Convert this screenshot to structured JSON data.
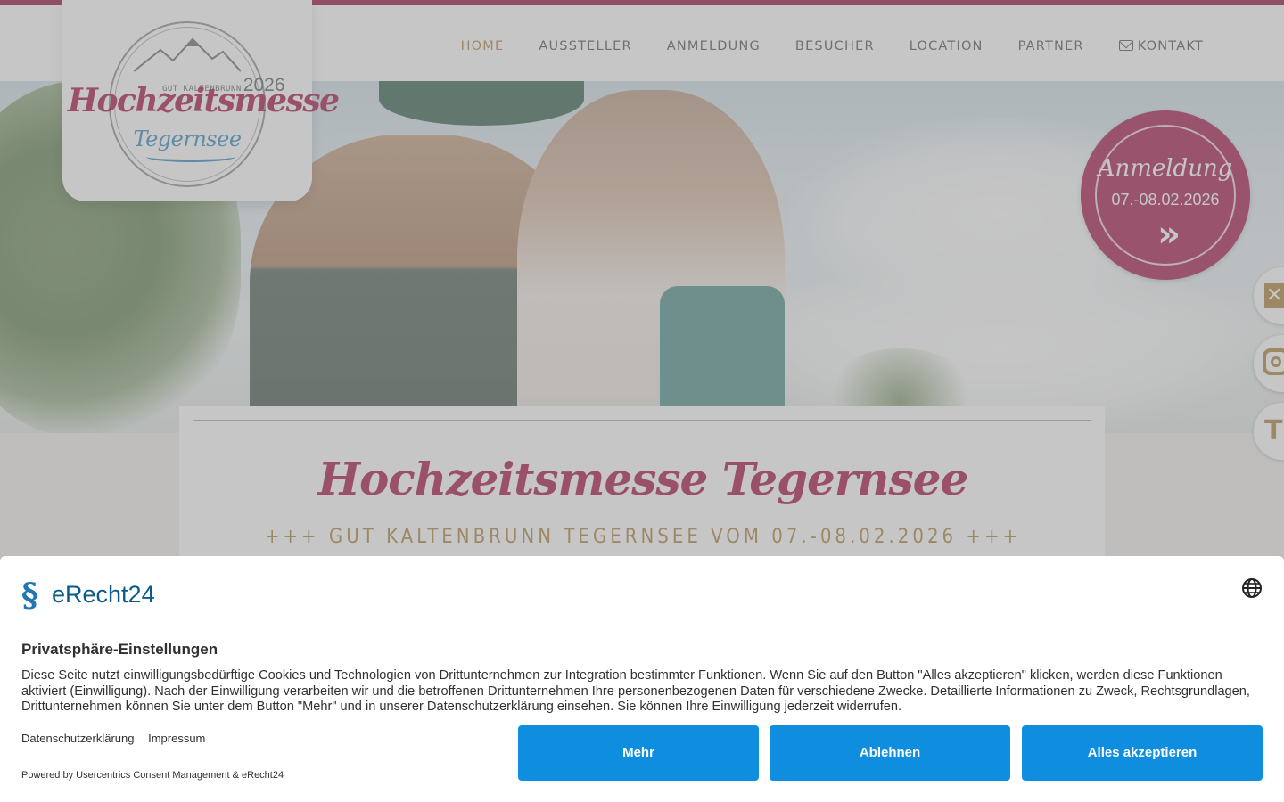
{
  "nav": {
    "items": [
      {
        "label": "HOME",
        "active": true
      },
      {
        "label": "AUSSTELLER",
        "active": false
      },
      {
        "label": "ANMELDUNG",
        "active": false
      },
      {
        "label": "BESUCHER",
        "active": false
      },
      {
        "label": "LOCATION",
        "active": false
      },
      {
        "label": "PARTNER",
        "active": false
      }
    ],
    "contact_label": "KONTAKT",
    "contact_icon": "envelope-icon"
  },
  "logo": {
    "place": "GUT KALTENBRUNN",
    "year": "2026",
    "title": "Hochzeitsmesse",
    "subtitle": "Tegernsee"
  },
  "badge": {
    "title": "Anmeldung",
    "dates": "07.-08.02.2026",
    "arrow": "»"
  },
  "social": [
    {
      "name": "x-icon"
    },
    {
      "name": "instagram-icon"
    },
    {
      "name": "t-icon",
      "glyph": "T"
    }
  ],
  "content": {
    "headline": "Hochzeitsmesse Tegernsee",
    "subline": "+++ GUT KALTENBRUNN TEGERNSEE VOM 07.-08.02.2026 +++"
  },
  "consent": {
    "brand": "eRecht24",
    "title": "Privatsphäre-Einstellungen",
    "text": "Diese Seite nutzt einwilligungsbedürftige Cookies und Technologien von Drittunternehmen zur Integration bestimmter Funktionen. Wenn Sie auf den Button \"Alles akzeptieren\" klicken, werden diese Funktionen aktiviert (Einwilligung). Nach der Einwilligung verarbeiten wir und die betroffenen Drittunternehmen Ihre personenbezogenen Daten für verschiedene Zwecke. Detaillierte Informationen zu Zweck, Rechtsgrundlagen, Drittunternehmen können Sie unter dem Button \"Mehr\" und in unserer Datenschutzerklärung einsehen. Sie können Ihre Einwilligung jederzeit widerrufen.",
    "link_privacy": "Datenschutzerklärung",
    "link_imprint": "Impressum",
    "powered": "Powered by Usercentrics Consent Management & eRecht24",
    "btn_more": "Mehr",
    "btn_deny": "Ablehnen",
    "btn_accept": "Alles akzeptieren"
  },
  "colors": {
    "brand": "#b2355e",
    "gold": "#b8955b",
    "button": "#0f8ee0"
  }
}
